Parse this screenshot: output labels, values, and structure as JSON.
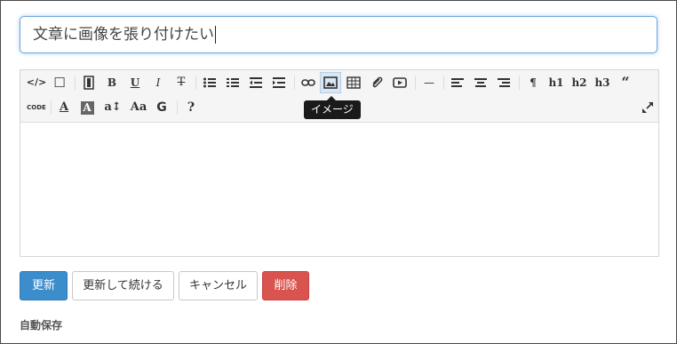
{
  "title_input": {
    "value": "文章に画像を張り付けたい"
  },
  "toolbar": {
    "row1": [
      {
        "name": "code-view-icon",
        "glyph": "</>"
      },
      {
        "name": "fullscreen-box-icon",
        "glyph": "☐"
      },
      {
        "name": "template-icon",
        "glyph": ""
      },
      {
        "name": "bold-icon",
        "glyph": "B"
      },
      {
        "name": "underline-icon",
        "glyph": "U"
      },
      {
        "name": "italic-icon",
        "glyph": "I"
      },
      {
        "name": "strikethrough-icon",
        "glyph": "T"
      },
      {
        "name": "unordered-list-icon",
        "glyph": ""
      },
      {
        "name": "ordered-list-icon",
        "glyph": ""
      },
      {
        "name": "outdent-icon",
        "glyph": ""
      },
      {
        "name": "indent-icon",
        "glyph": ""
      },
      {
        "name": "link-icon",
        "glyph": ""
      },
      {
        "name": "image-icon",
        "glyph": ""
      },
      {
        "name": "table-icon",
        "glyph": ""
      },
      {
        "name": "attachment-icon",
        "glyph": ""
      },
      {
        "name": "video-icon",
        "glyph": ""
      },
      {
        "name": "horizontal-rule-icon",
        "glyph": "—"
      },
      {
        "name": "align-left-icon",
        "glyph": ""
      },
      {
        "name": "align-center-icon",
        "glyph": ""
      },
      {
        "name": "align-right-icon",
        "glyph": ""
      },
      {
        "name": "paragraph-icon",
        "glyph": "¶"
      },
      {
        "name": "h1-icon",
        "glyph": "h1"
      },
      {
        "name": "h2-icon",
        "glyph": "h2"
      },
      {
        "name": "h3-icon",
        "glyph": "h3"
      },
      {
        "name": "quote-icon",
        "glyph": "“"
      }
    ],
    "row2": [
      {
        "name": "code-block-icon",
        "glyph": "CODE"
      },
      {
        "name": "font-color-icon",
        "glyph": "A"
      },
      {
        "name": "background-color-icon",
        "glyph": "A"
      },
      {
        "name": "line-height-icon",
        "glyph": "a↕"
      },
      {
        "name": "font-size-icon",
        "glyph": "Aa"
      },
      {
        "name": "font-family-icon",
        "glyph": "G"
      },
      {
        "name": "help-icon",
        "glyph": "?"
      }
    ],
    "expand_icon": "expand-icon"
  },
  "tooltip": {
    "text": "イメージ"
  },
  "buttons": {
    "update": "更新",
    "update_continue": "更新して続ける",
    "cancel": "キャンセル",
    "delete": "削除"
  },
  "autosave_label": "自動保存",
  "colors": {
    "primary": "#3c8dcc",
    "danger": "#d9534f",
    "focus_border": "#6fa7dd",
    "tooltip_bg": "#1a1a1a"
  }
}
